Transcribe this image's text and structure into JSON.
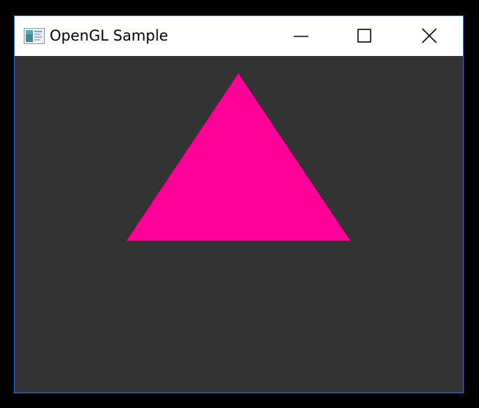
{
  "window": {
    "title": "OpenGL Sample",
    "app_icon": "window-app-icon",
    "controls": {
      "minimize_icon": "minimize-icon",
      "maximize_icon": "maximize-icon",
      "close_icon": "close-icon"
    }
  },
  "canvas": {
    "background_color": "#333333",
    "shape": "triangle",
    "shape_color": "#ff0099"
  },
  "colors": {
    "title_bar": "#ffffff",
    "window_border": "#2b78d0",
    "desktop": "#000000"
  }
}
